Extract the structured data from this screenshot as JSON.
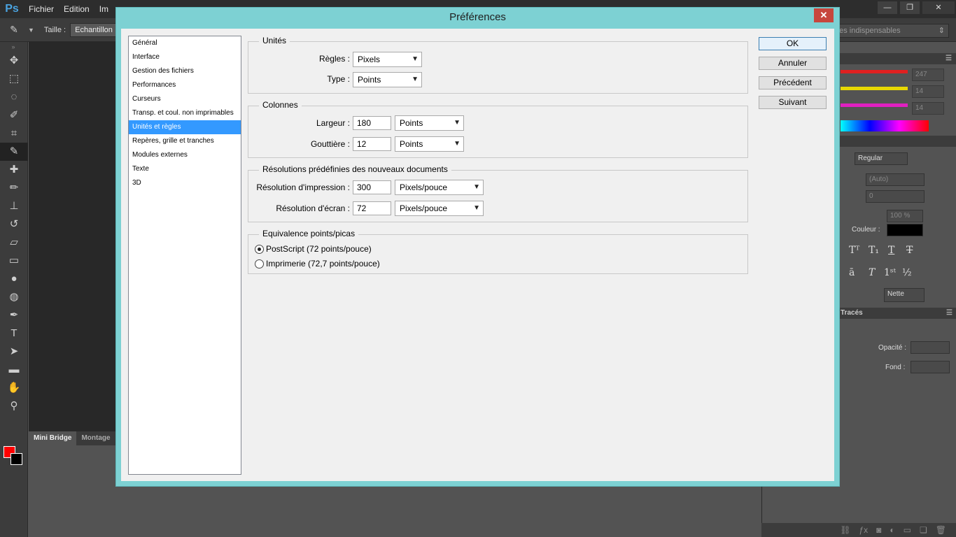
{
  "app": {
    "logo": "Ps",
    "menu": [
      "Fichier",
      "Edition",
      "Im"
    ],
    "window_controls": [
      "—",
      "❐",
      "✕"
    ]
  },
  "options_bar": {
    "size_label": "Taille :",
    "size_value": "Echantillon"
  },
  "workspace": {
    "value": "Les indispensables"
  },
  "bottom_tabs": [
    "Mini Bridge",
    "Montage"
  ],
  "right_panel": {
    "color_values": [
      "247",
      "14",
      "14"
    ],
    "font_style": "Regular",
    "leading": "(Auto)",
    "tracking": "0",
    "scale": "100 %",
    "color_label": "Couleur :",
    "aa_value": "Nette",
    "layers_tab": "Tracés",
    "opacity_label": "Opacité :",
    "fill_label": "Fond :"
  },
  "dialog": {
    "title": "Préférences",
    "close": "✕",
    "categories": [
      "Général",
      "Interface",
      "Gestion des fichiers",
      "Performances",
      "Curseurs",
      "Transp. et coul. non imprimables",
      "Unités et règles",
      "Repères, grille et tranches",
      "Modules externes",
      "Texte",
      "3D"
    ],
    "selected_category": "Unités et règles",
    "units": {
      "title": "Unités",
      "rulers_label": "Règles :",
      "rulers_value": "Pixels",
      "type_label": "Type :",
      "type_value": "Points"
    },
    "columns": {
      "title": "Colonnes",
      "width_label": "Largeur :",
      "width_value": "180",
      "width_unit": "Points",
      "gutter_label": "Gouttière :",
      "gutter_value": "12",
      "gutter_unit": "Points"
    },
    "resolutions": {
      "title": "Résolutions prédéfinies des nouveaux documents",
      "print_label": "Résolution d'impression :",
      "print_value": "300",
      "print_unit": "Pixels/pouce",
      "screen_label": "Résolution d'écran :",
      "screen_value": "72",
      "screen_unit": "Pixels/pouce"
    },
    "points_picas": {
      "title": "Equivalence points/picas",
      "option_postscript": "PostScript (72 points/pouce)",
      "option_traditional": "Imprimerie (72,7 points/pouce)",
      "selected": "postscript"
    },
    "buttons": {
      "ok": "OK",
      "cancel": "Annuler",
      "prev": "Précédent",
      "next": "Suivant"
    }
  }
}
